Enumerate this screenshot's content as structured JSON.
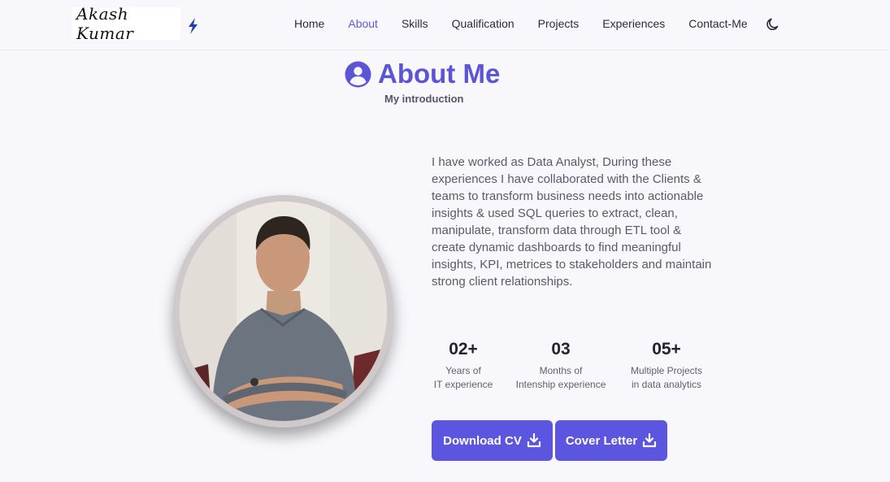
{
  "brand": {
    "logo_text": "Akash Kumar"
  },
  "nav": {
    "items": [
      {
        "label": "Home",
        "active": false
      },
      {
        "label": "About",
        "active": true
      },
      {
        "label": "Skills",
        "active": false
      },
      {
        "label": "Qualification",
        "active": false
      },
      {
        "label": "Projects",
        "active": false
      },
      {
        "label": "Experiences",
        "active": false
      },
      {
        "label": "Contact-Me",
        "active": false
      }
    ],
    "theme_icon": "moon-icon"
  },
  "about": {
    "title": "About Me",
    "subtitle": "My introduction",
    "description": "I have worked as Data Analyst, During these experiences I have collaborated with the Clients & teams to transform business needs into actionable insights & used SQL queries to extract, clean, manipulate, transform data through ETL tool & create dynamic dashboards to find meaningful insights, KPI, metrices to stakeholders and maintain strong client relationships.",
    "stats": [
      {
        "number": "02+",
        "label_line1": "Years of",
        "label_line2": "IT experience"
      },
      {
        "number": "03",
        "label_line1": "Months of",
        "label_line2": "Intenship experience"
      },
      {
        "number": "05+",
        "label_line1": "Multiple Projects",
        "label_line2": "in data analytics"
      }
    ],
    "buttons": {
      "download_cv": "Download CV",
      "cover_letter": "Cover Letter"
    }
  },
  "colors": {
    "accent": "#5b55e0",
    "title": "#5b55d6",
    "nav_active": "#5b5bd6",
    "background": "#f8f8fc"
  }
}
